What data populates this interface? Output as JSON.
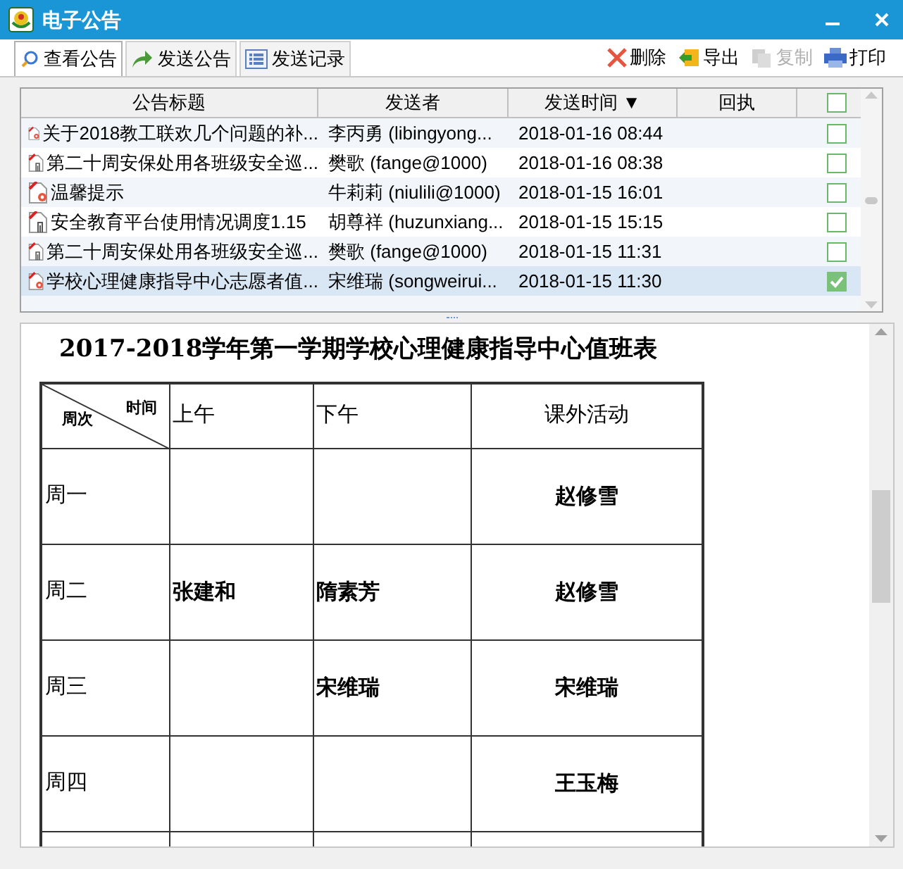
{
  "window": {
    "title": "电子公告"
  },
  "tabs": [
    {
      "label": "查看公告",
      "selected": true,
      "kind": "search"
    },
    {
      "label": "发送公告",
      "selected": false,
      "kind": "send"
    },
    {
      "label": "发送记录",
      "selected": false,
      "kind": "list"
    }
  ],
  "actions": [
    {
      "label": "删除",
      "kind": "delete",
      "disabled": false
    },
    {
      "label": "导出",
      "kind": "export",
      "disabled": false
    },
    {
      "label": "复制",
      "kind": "copy",
      "disabled": true
    },
    {
      "label": "打印",
      "kind": "print",
      "disabled": false
    }
  ],
  "table": {
    "columns": [
      "公告标题",
      "发送者",
      "发送时间 ▼",
      "回执"
    ],
    "header_checked": false,
    "rows": [
      {
        "kind": "unread",
        "title": "关于2018教工联欢几个问题的补...",
        "sender": "李丙勇 (libingyong...",
        "time": "2018-01-16 08:44",
        "checked": false,
        "selected": false
      },
      {
        "kind": "attachment",
        "title": "第二十周安保处用各班级安全巡...",
        "sender": "樊歌 (fange@1000)",
        "time": "2018-01-16 08:38",
        "checked": false,
        "selected": false
      },
      {
        "kind": "unread",
        "title": "温馨提示",
        "sender": "牛莉莉 (niulili@1000)",
        "time": "2018-01-15 16:01",
        "checked": false,
        "selected": false
      },
      {
        "kind": "attachment",
        "title": "安全教育平台使用情况调度1.15",
        "sender": "胡尊祥 (huzunxiang...",
        "time": "2018-01-15 15:15",
        "checked": false,
        "selected": false
      },
      {
        "kind": "attachment",
        "title": "第二十周安保处用各班级安全巡...",
        "sender": "樊歌 (fange@1000)",
        "time": "2018-01-15 11:31",
        "checked": false,
        "selected": false
      },
      {
        "kind": "unread",
        "title": "学校心理健康指导中心志愿者值...",
        "sender": "宋维瑞 (songweirui...",
        "time": "2018-01-15 11:30",
        "checked": true,
        "selected": true
      }
    ]
  },
  "document": {
    "heading": "2017-2018学年第一学期学校心理健康指导中心值班表",
    "columns": [
      {
        "kind": "diagonal",
        "top": "时间",
        "bottom": "周次"
      },
      {
        "kind": "text",
        "label": "上午"
      },
      {
        "kind": "text",
        "label": "下午"
      },
      {
        "kind": "text",
        "label": "课外活动"
      }
    ],
    "rows": [
      [
        "周一",
        "",
        "",
        "赵修雪"
      ],
      [
        "周二",
        "张建和",
        "隋素芳",
        "赵修雪"
      ],
      [
        "周三",
        "",
        "宋维瑞",
        "宋维瑞"
      ],
      [
        "周四",
        "",
        "",
        "王玉梅"
      ]
    ]
  }
}
